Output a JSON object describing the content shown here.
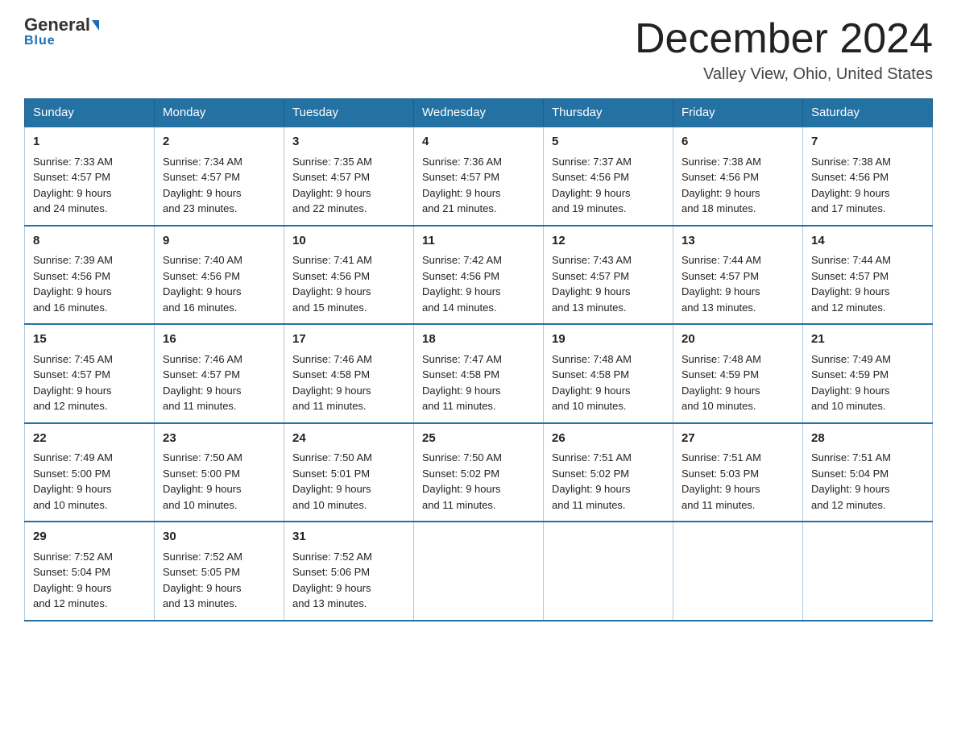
{
  "header": {
    "logo_main": "General",
    "logo_sub": "Blue",
    "title": "December 2024",
    "subtitle": "Valley View, Ohio, United States"
  },
  "days_of_week": [
    "Sunday",
    "Monday",
    "Tuesday",
    "Wednesday",
    "Thursday",
    "Friday",
    "Saturday"
  ],
  "weeks": [
    [
      {
        "day": 1,
        "sunrise": "7:33 AM",
        "sunset": "4:57 PM",
        "daylight": "9 hours and 24 minutes."
      },
      {
        "day": 2,
        "sunrise": "7:34 AM",
        "sunset": "4:57 PM",
        "daylight": "9 hours and 23 minutes."
      },
      {
        "day": 3,
        "sunrise": "7:35 AM",
        "sunset": "4:57 PM",
        "daylight": "9 hours and 22 minutes."
      },
      {
        "day": 4,
        "sunrise": "7:36 AM",
        "sunset": "4:57 PM",
        "daylight": "9 hours and 21 minutes."
      },
      {
        "day": 5,
        "sunrise": "7:37 AM",
        "sunset": "4:56 PM",
        "daylight": "9 hours and 19 minutes."
      },
      {
        "day": 6,
        "sunrise": "7:38 AM",
        "sunset": "4:56 PM",
        "daylight": "9 hours and 18 minutes."
      },
      {
        "day": 7,
        "sunrise": "7:38 AM",
        "sunset": "4:56 PM",
        "daylight": "9 hours and 17 minutes."
      }
    ],
    [
      {
        "day": 8,
        "sunrise": "7:39 AM",
        "sunset": "4:56 PM",
        "daylight": "9 hours and 16 minutes."
      },
      {
        "day": 9,
        "sunrise": "7:40 AM",
        "sunset": "4:56 PM",
        "daylight": "9 hours and 16 minutes."
      },
      {
        "day": 10,
        "sunrise": "7:41 AM",
        "sunset": "4:56 PM",
        "daylight": "9 hours and 15 minutes."
      },
      {
        "day": 11,
        "sunrise": "7:42 AM",
        "sunset": "4:56 PM",
        "daylight": "9 hours and 14 minutes."
      },
      {
        "day": 12,
        "sunrise": "7:43 AM",
        "sunset": "4:57 PM",
        "daylight": "9 hours and 13 minutes."
      },
      {
        "day": 13,
        "sunrise": "7:44 AM",
        "sunset": "4:57 PM",
        "daylight": "9 hours and 13 minutes."
      },
      {
        "day": 14,
        "sunrise": "7:44 AM",
        "sunset": "4:57 PM",
        "daylight": "9 hours and 12 minutes."
      }
    ],
    [
      {
        "day": 15,
        "sunrise": "7:45 AM",
        "sunset": "4:57 PM",
        "daylight": "9 hours and 12 minutes."
      },
      {
        "day": 16,
        "sunrise": "7:46 AM",
        "sunset": "4:57 PM",
        "daylight": "9 hours and 11 minutes."
      },
      {
        "day": 17,
        "sunrise": "7:46 AM",
        "sunset": "4:58 PM",
        "daylight": "9 hours and 11 minutes."
      },
      {
        "day": 18,
        "sunrise": "7:47 AM",
        "sunset": "4:58 PM",
        "daylight": "9 hours and 11 minutes."
      },
      {
        "day": 19,
        "sunrise": "7:48 AM",
        "sunset": "4:58 PM",
        "daylight": "9 hours and 10 minutes."
      },
      {
        "day": 20,
        "sunrise": "7:48 AM",
        "sunset": "4:59 PM",
        "daylight": "9 hours and 10 minutes."
      },
      {
        "day": 21,
        "sunrise": "7:49 AM",
        "sunset": "4:59 PM",
        "daylight": "9 hours and 10 minutes."
      }
    ],
    [
      {
        "day": 22,
        "sunrise": "7:49 AM",
        "sunset": "5:00 PM",
        "daylight": "9 hours and 10 minutes."
      },
      {
        "day": 23,
        "sunrise": "7:50 AM",
        "sunset": "5:00 PM",
        "daylight": "9 hours and 10 minutes."
      },
      {
        "day": 24,
        "sunrise": "7:50 AM",
        "sunset": "5:01 PM",
        "daylight": "9 hours and 10 minutes."
      },
      {
        "day": 25,
        "sunrise": "7:50 AM",
        "sunset": "5:02 PM",
        "daylight": "9 hours and 11 minutes."
      },
      {
        "day": 26,
        "sunrise": "7:51 AM",
        "sunset": "5:02 PM",
        "daylight": "9 hours and 11 minutes."
      },
      {
        "day": 27,
        "sunrise": "7:51 AM",
        "sunset": "5:03 PM",
        "daylight": "9 hours and 11 minutes."
      },
      {
        "day": 28,
        "sunrise": "7:51 AM",
        "sunset": "5:04 PM",
        "daylight": "9 hours and 12 minutes."
      }
    ],
    [
      {
        "day": 29,
        "sunrise": "7:52 AM",
        "sunset": "5:04 PM",
        "daylight": "9 hours and 12 minutes."
      },
      {
        "day": 30,
        "sunrise": "7:52 AM",
        "sunset": "5:05 PM",
        "daylight": "9 hours and 13 minutes."
      },
      {
        "day": 31,
        "sunrise": "7:52 AM",
        "sunset": "5:06 PM",
        "daylight": "9 hours and 13 minutes."
      },
      null,
      null,
      null,
      null
    ]
  ],
  "labels": {
    "sunrise": "Sunrise:",
    "sunset": "Sunset:",
    "daylight": "Daylight:"
  }
}
